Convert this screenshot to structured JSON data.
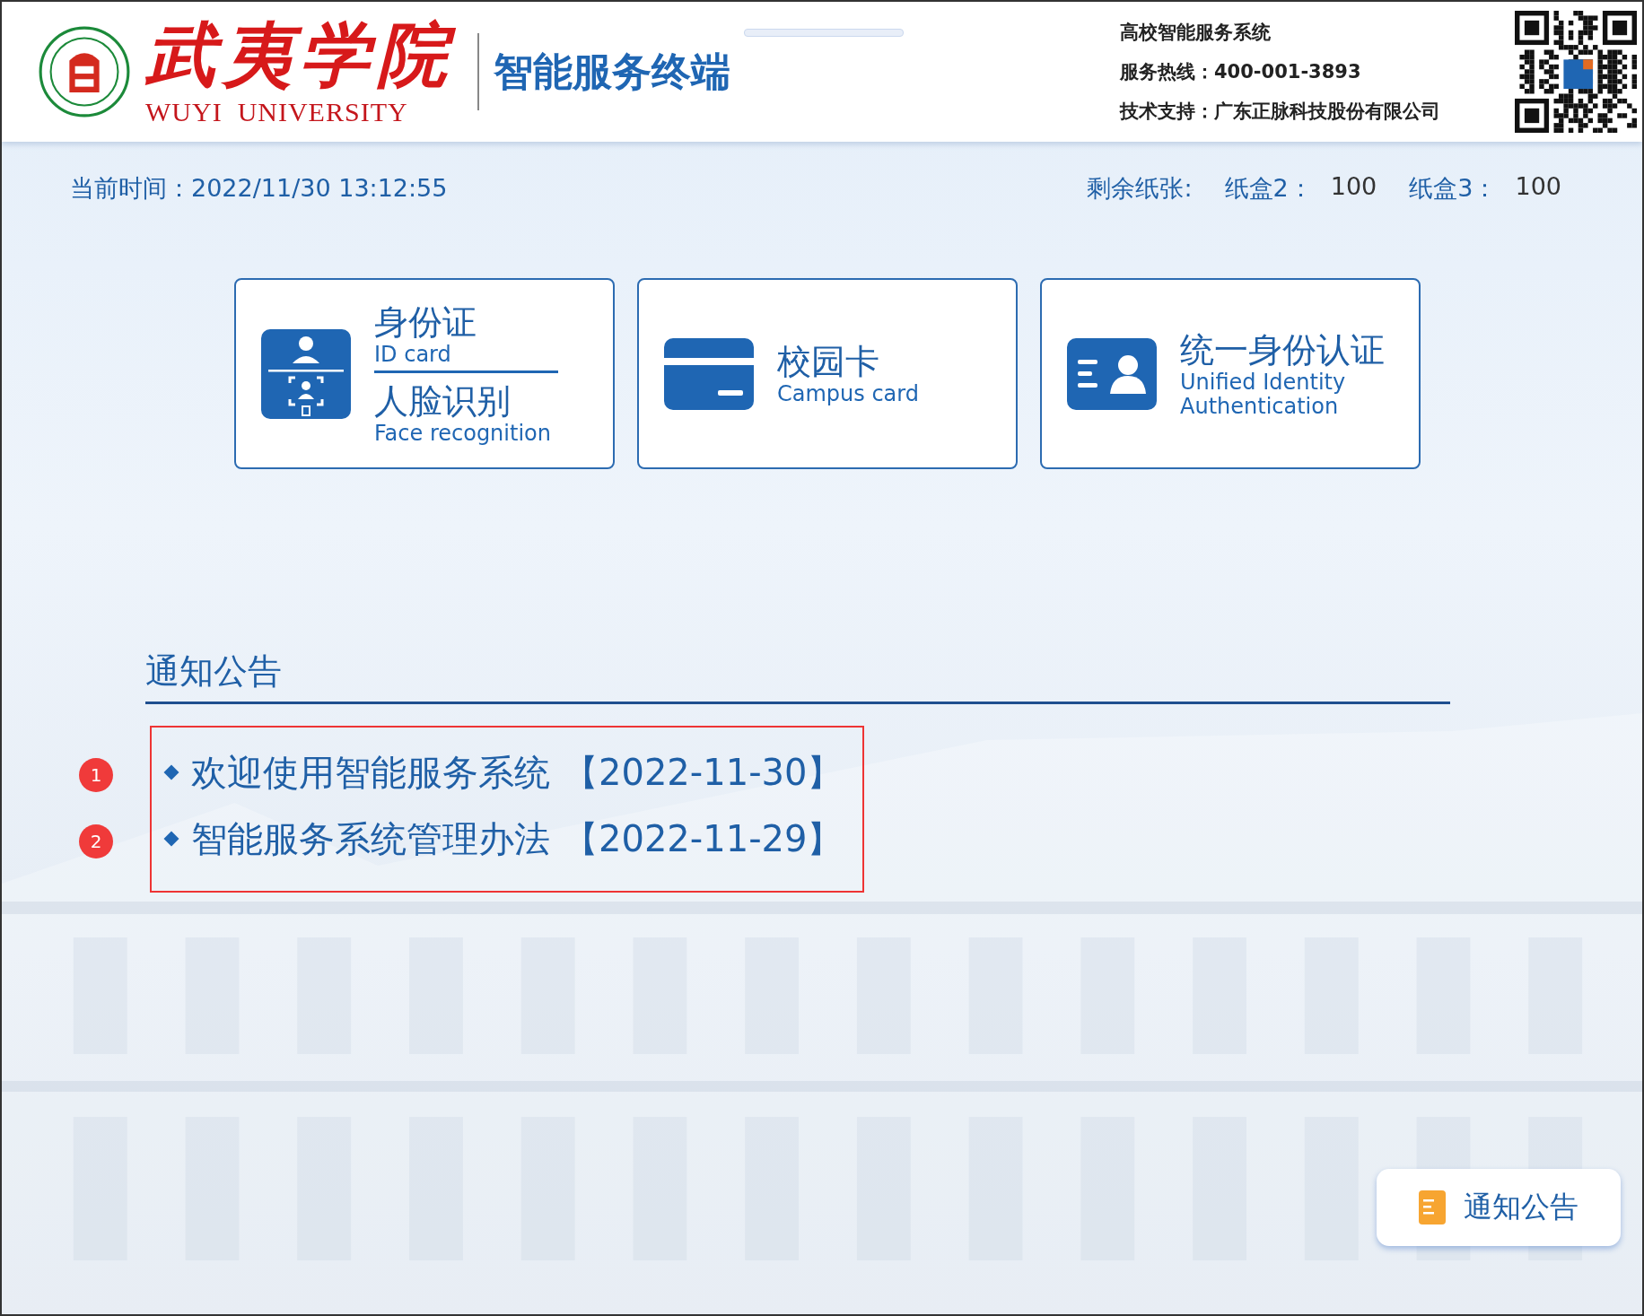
{
  "header": {
    "school_name": "武夷学院",
    "school_name_en": "WUYI  UNIVERSITY",
    "terminal_title": "智能服务终端",
    "info_lines": [
      {
        "label": "高校智能服务系统"
      },
      {
        "label": "服务热线：",
        "value": "400-001-3893"
      },
      {
        "label": "技术支持：",
        "value": "广东正脉科技股份有限公司"
      }
    ]
  },
  "status_row": {
    "time_label": "当前时间：",
    "time_value": "2022/11/30 13:12:55",
    "paper_label": "剩余纸张:",
    "trays": [
      {
        "name": "纸盒2：",
        "count": "100"
      },
      {
        "name": "纸盒3：",
        "count": "100"
      }
    ]
  },
  "login_cards": [
    {
      "kind": "id-face",
      "title": "身份证",
      "subtitle": "ID card",
      "title2": "人脸识别",
      "subtitle2": "Face recognition"
    },
    {
      "kind": "campus-card",
      "title": "校园卡",
      "subtitle": "Campus card"
    },
    {
      "kind": "identity",
      "title": "统一身份认证",
      "subtitle": "Unified Identity\nAuthentication"
    }
  ],
  "notices": {
    "heading": "通知公告",
    "items": [
      {
        "marker": "1",
        "title": "欢迎使用智能服务系统",
        "date": "【2022-11-30】"
      },
      {
        "marker": "2",
        "title": "智能服务系统管理办法",
        "date": "【2022-11-29】"
      }
    ]
  },
  "float_button": {
    "label": "通知公告"
  }
}
